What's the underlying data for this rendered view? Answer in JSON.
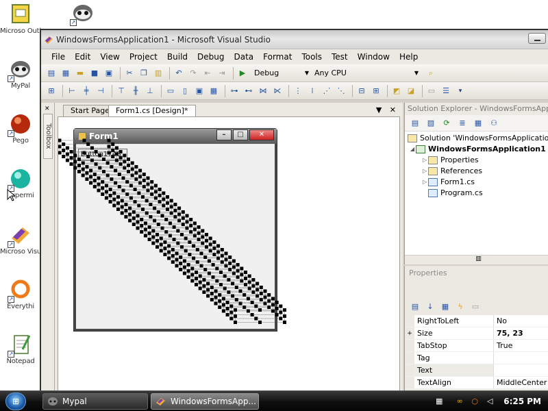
{
  "desktop": {
    "icons": [
      {
        "label": "Microso Outloo",
        "icon": "outlook-icon"
      },
      {
        "label": "",
        "icon": "raccoon-icon"
      },
      {
        "label": "MyPal",
        "icon": "raccoon-icon"
      },
      {
        "label": "Pego",
        "icon": "pego-icon"
      },
      {
        "label": "Expermi",
        "icon": "orb-icon"
      },
      {
        "label": "Microso Visual Stu",
        "icon": "visual-studio-icon"
      },
      {
        "label": "Everythi",
        "icon": "search-ring-icon"
      },
      {
        "label": "Notepad",
        "icon": "notepad-icon"
      }
    ]
  },
  "window": {
    "title": "WindowsFormsApplication1 - Microsoft Visual Studio"
  },
  "menu": [
    "File",
    "Edit",
    "View",
    "Project",
    "Build",
    "Debug",
    "Data",
    "Format",
    "Tools",
    "Test",
    "Window",
    "Help"
  ],
  "toolbar": {
    "config": "Debug",
    "platform": "Any CPU"
  },
  "toolbox_label": "Toolbox",
  "doc_tabs": {
    "start_page": "Start Page",
    "active": "Form1.cs [Design]*"
  },
  "form_preview": {
    "title": "Form1",
    "button_text": "button1748"
  },
  "solution_explorer": {
    "title": "Solution Explorer - WindowsFormsApp...",
    "solution": "Solution 'WindowsFormsApplicatio",
    "project": "WindowsFormsApplication1",
    "items": [
      "Properties",
      "References",
      "Form1.cs",
      "Program.cs"
    ]
  },
  "properties": {
    "title": "Properties",
    "rows": [
      {
        "name": "RightToLeft",
        "value": "No",
        "bold": false,
        "expand": ""
      },
      {
        "name": "Size",
        "value": "75, 23",
        "bold": true,
        "expand": "+"
      },
      {
        "name": "TabStop",
        "value": "True",
        "bold": false,
        "expand": ""
      },
      {
        "name": "Tag",
        "value": "",
        "bold": false,
        "expand": ""
      },
      {
        "name": "Text",
        "value": "",
        "bold": false,
        "expand": ""
      },
      {
        "name": "TextAlign",
        "value": "MiddleCenter",
        "bold": false,
        "expand": ""
      }
    ]
  },
  "taskbar": {
    "tasks": [
      "Mypal",
      "WindowsFormsApp..."
    ],
    "clock": "6:25 PM"
  }
}
